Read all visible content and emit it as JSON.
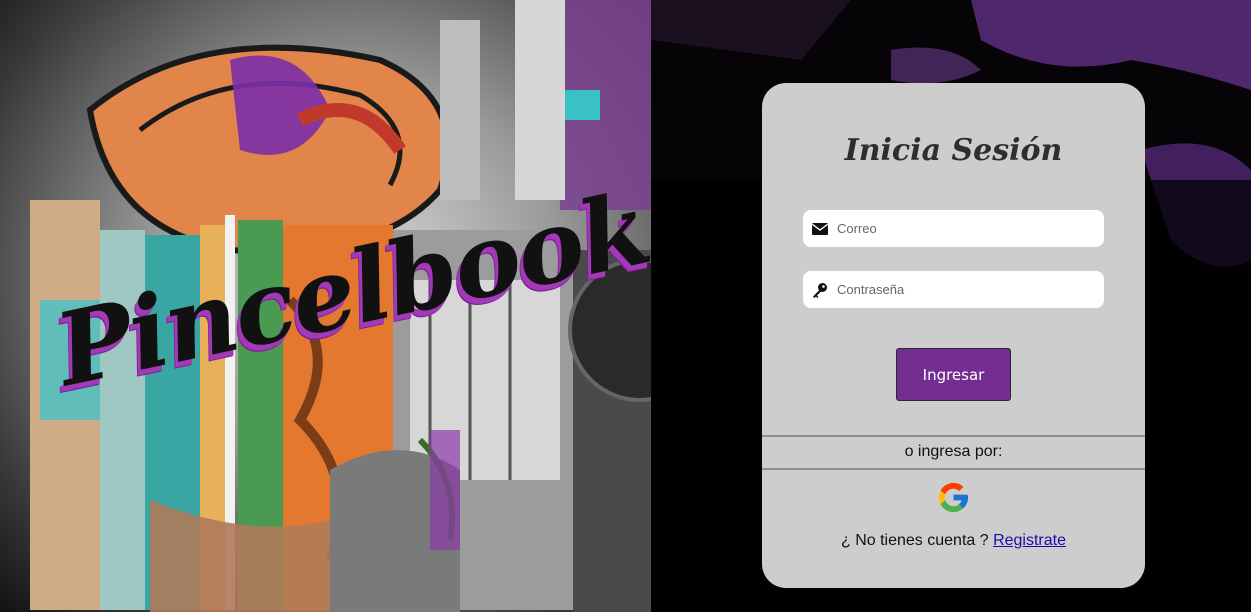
{
  "brand": {
    "name": "Pincelbook"
  },
  "login": {
    "title": "Inicia Sesión",
    "email": {
      "placeholder": "Correo",
      "value": ""
    },
    "password": {
      "placeholder": "Contraseña",
      "value": ""
    },
    "submit_label": "Ingresar",
    "alt_login_text": "o ingresa por:",
    "signup_prompt": "¿ No tienes cuenta ?",
    "signup_link": "Registrate"
  },
  "colors": {
    "accent": "#742d91",
    "card_bg": "#cdcdcd",
    "brand_shadow": "#a23ab8"
  },
  "icons": {
    "email": "envelope-icon",
    "password": "key-icon",
    "google": "google-icon"
  }
}
